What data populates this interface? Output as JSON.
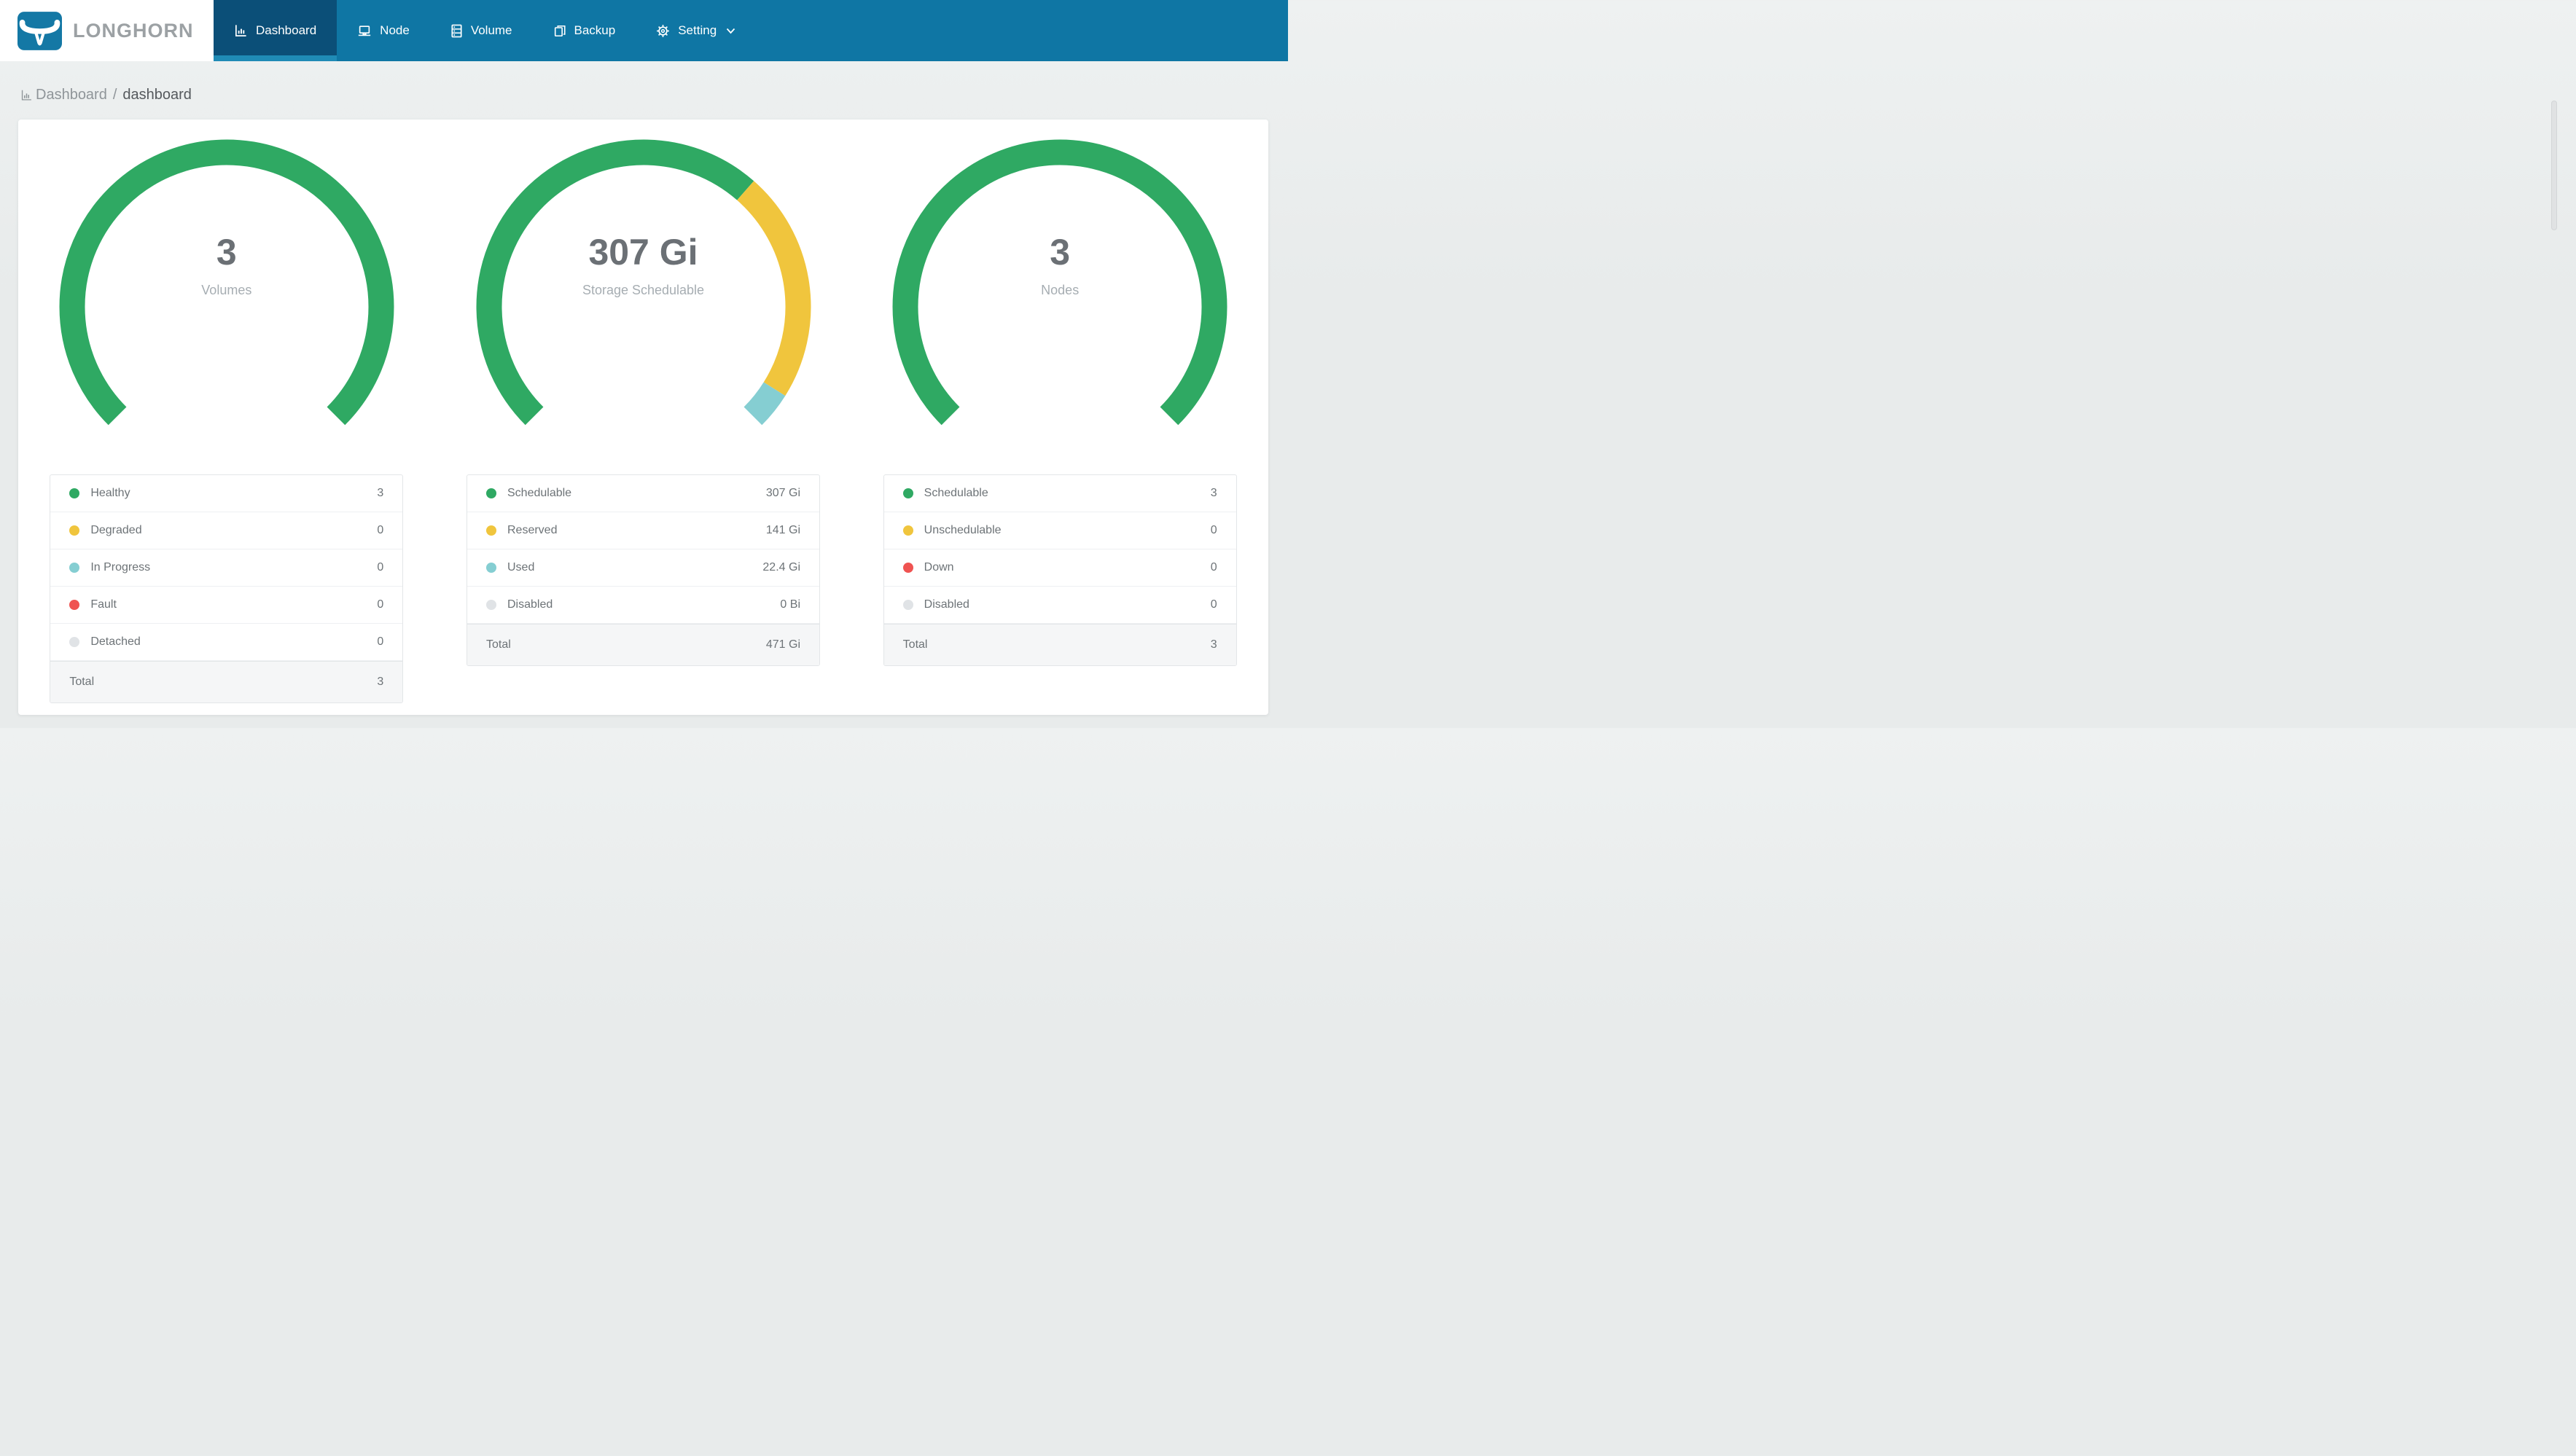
{
  "brand": {
    "title": "LONGHORN"
  },
  "nav": {
    "items": [
      {
        "label": "Dashboard",
        "icon": "bar-chart-icon",
        "active": true
      },
      {
        "label": "Node",
        "icon": "laptop-icon",
        "active": false
      },
      {
        "label": "Volume",
        "icon": "server-stack-icon",
        "active": false
      },
      {
        "label": "Backup",
        "icon": "copy-pages-icon",
        "active": false
      },
      {
        "label": "Setting",
        "icon": "gear-icon",
        "active": false,
        "dropdown": true
      }
    ]
  },
  "breadcrumb": {
    "section": "Dashboard",
    "separator": "/",
    "page": "dashboard"
  },
  "colors": {
    "navbar": "#0F76A4",
    "navbar_active": "#0B4F78",
    "navbar_active_underline": "#1F8BB6",
    "page_bg": "#E9ECEC",
    "card_bg": "#FFFFFF",
    "green": "#2FA963",
    "yellow": "#F0C53D",
    "teal": "#85CED2",
    "red": "#EF5351",
    "gray": "#E0E3E6"
  },
  "chart_data": [
    {
      "type": "donut-gauge",
      "title": "Volumes",
      "center_value": "3",
      "center_label": "Volumes",
      "sweep_deg": 270,
      "segments": [
        {
          "label": "Healthy",
          "value": 3,
          "display": "3",
          "color": "#2FA963"
        },
        {
          "label": "Degraded",
          "value": 0,
          "display": "0",
          "color": "#F0C53D"
        },
        {
          "label": "In Progress",
          "value": 0,
          "display": "0",
          "color": "#85CED2"
        },
        {
          "label": "Fault",
          "value": 0,
          "display": "0",
          "color": "#EF5351"
        },
        {
          "label": "Detached",
          "value": 0,
          "display": "0",
          "color": "#E0E3E6"
        }
      ],
      "total": {
        "label": "Total",
        "value": 3,
        "display": "3"
      }
    },
    {
      "type": "donut-gauge",
      "title": "Storage Schedulable",
      "center_value": "307 Gi",
      "center_label": "Storage Schedulable",
      "sweep_deg": 270,
      "segments": [
        {
          "label": "Schedulable",
          "value": 307,
          "display": "307 Gi",
          "color": "#2FA963"
        },
        {
          "label": "Reserved",
          "value": 141,
          "display": "141 Gi",
          "color": "#F0C53D"
        },
        {
          "label": "Used",
          "value": 22.4,
          "display": "22.4 Gi",
          "color": "#85CED2"
        },
        {
          "label": "Disabled",
          "value": 0,
          "display": "0 Bi",
          "color": "#E0E3E6"
        }
      ],
      "total": {
        "label": "Total",
        "value": 471,
        "display": "471 Gi"
      }
    },
    {
      "type": "donut-gauge",
      "title": "Nodes",
      "center_value": "3",
      "center_label": "Nodes",
      "sweep_deg": 270,
      "segments": [
        {
          "label": "Schedulable",
          "value": 3,
          "display": "3",
          "color": "#2FA963"
        },
        {
          "label": "Unschedulable",
          "value": 0,
          "display": "0",
          "color": "#F0C53D"
        },
        {
          "label": "Down",
          "value": 0,
          "display": "0",
          "color": "#EF5351"
        },
        {
          "label": "Disabled",
          "value": 0,
          "display": "0",
          "color": "#E0E3E6"
        }
      ],
      "total": {
        "label": "Total",
        "value": 3,
        "display": "3"
      }
    }
  ]
}
